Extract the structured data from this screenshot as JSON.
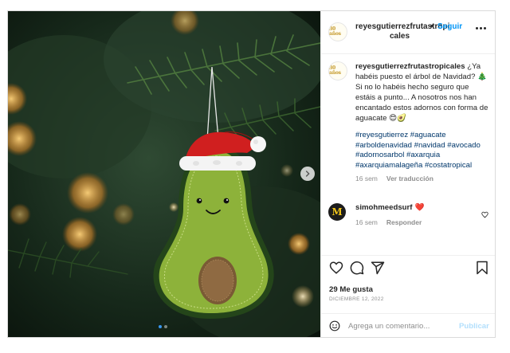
{
  "post": {
    "image_alt": "Adorno de fieltro con forma de aguacate y gorro de Papá Noel en un árbol de Navidad",
    "carousel_dots": 2,
    "carousel_active_index": 0
  },
  "header": {
    "avatar_text": "30 años",
    "username_line1": "reyesgutierrezfrutastropi",
    "username_line2": "cales",
    "separator": "•",
    "follow_label": "Seguir"
  },
  "caption": {
    "username": "reyesgutierrezfrutastropicales",
    "text": " ¿Ya habéis puesto el árbol de Navidad? 🎄 Si no lo habéis hecho seguro que estáis a punto... A nosotros nos han encantado estos adornos con forma de aguacate 😍🥑",
    "hashtags": [
      "#reyesgutierrez",
      "#aguacate",
      "#arboldenavidad",
      "#navidad",
      "#avocado",
      "#adornosarbol",
      "#axarquia",
      "#axarquiamalageña",
      "#costatropical"
    ],
    "time": "16 sem",
    "translate_label": "Ver traducción"
  },
  "comment": {
    "avatar_letter": "M",
    "username": "simohmeedsurf",
    "emoji": "❤️",
    "time": "16 sem",
    "reply_label": "Responder"
  },
  "stats": {
    "likes": "29 Me gusta",
    "date": "DICIEMBRE 12, 2022"
  },
  "comment_input": {
    "placeholder": "Agrega un comentario...",
    "publish_label": "Publicar"
  },
  "icons": {
    "like": "heart-icon",
    "comment": "comment-bubble-icon",
    "share": "paper-plane-icon",
    "save": "bookmark-icon",
    "emoji": "smiley-icon",
    "next": "chevron-right-icon",
    "more": "more-options-icon"
  },
  "colors": {
    "link_blue": "#0095f6",
    "hashtag": "#00376b",
    "muted": "#8e8e8e",
    "publish_disabled": "#b2dffc",
    "heart_red": "#ed4956"
  }
}
